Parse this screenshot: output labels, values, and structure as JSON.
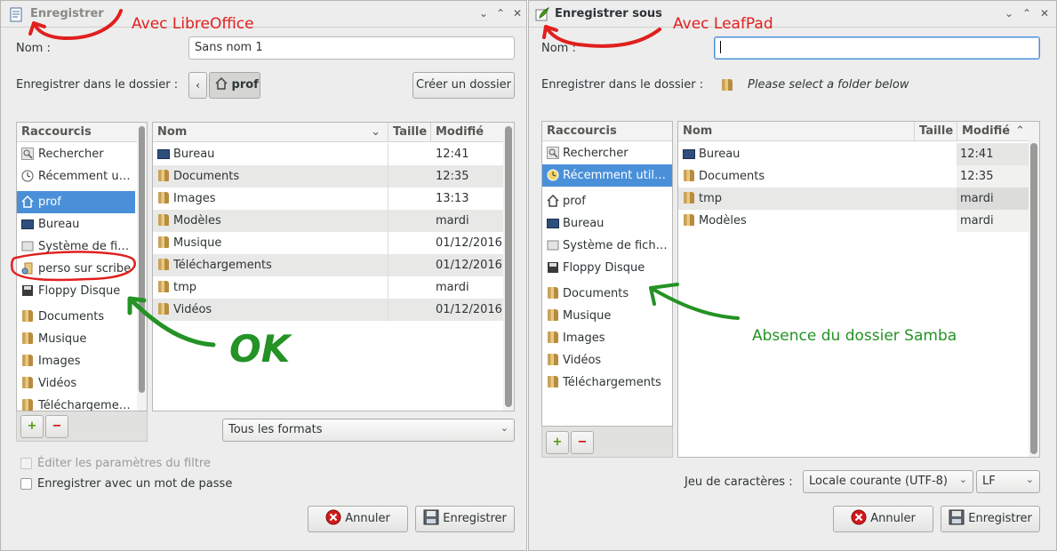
{
  "libreoffice": {
    "title": "Enregistrer",
    "annotation": "Avec LibreOffice",
    "name_label": "Nom :",
    "name_value": "Sans nom 1",
    "folder_label": "Enregistrer dans le dossier :",
    "path_current": "prof",
    "create_folder": "Créer un dossier",
    "places_header": "Raccourcis",
    "places": [
      {
        "label": "Rechercher",
        "icon": "search-icon"
      },
      {
        "label": "Récemment u…",
        "icon": "recent-icon"
      },
      {
        "label": "prof",
        "icon": "home-icon"
      },
      {
        "label": "Bureau",
        "icon": "desktop-icon"
      },
      {
        "label": "Système de fi…",
        "icon": "drive-icon"
      },
      {
        "label": "perso sur scribe",
        "icon": "network-icon"
      },
      {
        "label": "Floppy Disque",
        "icon": "floppy-icon"
      },
      {
        "label": "Documents",
        "icon": "folder-icon"
      },
      {
        "label": "Musique",
        "icon": "folder-icon"
      },
      {
        "label": "Images",
        "icon": "folder-icon"
      },
      {
        "label": "Vidéos",
        "icon": "folder-icon"
      },
      {
        "label": "Téléchargeme…",
        "icon": "folder-icon"
      }
    ],
    "columns": {
      "name": "Nom",
      "size": "Taille",
      "modified": "Modifié"
    },
    "files": [
      {
        "name": "Bureau",
        "size": "",
        "modified": "12:41"
      },
      {
        "name": "Documents",
        "size": "",
        "modified": "12:35"
      },
      {
        "name": "Images",
        "size": "",
        "modified": "13:13"
      },
      {
        "name": "Modèles",
        "size": "",
        "modified": "mardi"
      },
      {
        "name": "Musique",
        "size": "",
        "modified": "01/12/2016"
      },
      {
        "name": "Téléchargements",
        "size": "",
        "modified": "01/12/2016"
      },
      {
        "name": "tmp",
        "size": "",
        "modified": "mardi"
      },
      {
        "name": "Vidéos",
        "size": "",
        "modified": "01/12/2016"
      }
    ],
    "filter_value": "Tous les formats",
    "check_filter": "Éditer les paramètres du filtre",
    "check_password": "Enregistrer avec un mot de passe",
    "cancel": "Annuler",
    "save": "Enregistrer",
    "ok_annotation": "OK"
  },
  "leafpad": {
    "title": "Enregistrer sous",
    "annotation": "Avec LeafPad",
    "name_label": "Nom :",
    "name_value": "",
    "folder_label": "Enregistrer dans le dossier :",
    "folder_hint": "Please select a folder below",
    "places_header": "Raccourcis",
    "places": [
      {
        "label": "Rechercher",
        "icon": "search-icon"
      },
      {
        "label": "Récemment util…",
        "icon": "recent-icon"
      },
      {
        "label": "prof",
        "icon": "home-icon"
      },
      {
        "label": "Bureau",
        "icon": "desktop-icon"
      },
      {
        "label": "Système de fich…",
        "icon": "drive-icon"
      },
      {
        "label": "Floppy Disque",
        "icon": "floppy-icon"
      },
      {
        "label": "Documents",
        "icon": "folder-icon"
      },
      {
        "label": "Musique",
        "icon": "folder-icon"
      },
      {
        "label": "Images",
        "icon": "folder-icon"
      },
      {
        "label": "Vidéos",
        "icon": "folder-icon"
      },
      {
        "label": "Téléchargements",
        "icon": "folder-icon"
      }
    ],
    "columns": {
      "name": "Nom",
      "size": "Taille",
      "modified": "Modifié"
    },
    "files": [
      {
        "name": "Bureau",
        "size": "",
        "modified": "12:41"
      },
      {
        "name": "Documents",
        "size": "",
        "modified": "12:35"
      },
      {
        "name": "tmp",
        "size": "",
        "modified": "mardi"
      },
      {
        "name": "Modèles",
        "size": "",
        "modified": "mardi"
      }
    ],
    "charset_label": "Jeu de caractères :",
    "charset_value": "Locale courante (UTF-8)",
    "eol_value": "LF",
    "cancel": "Annuler",
    "save": "Enregistrer",
    "samba_annotation": "Absence du dossier Samba"
  },
  "colors": {
    "selection": "#4a90d9",
    "annotation_red": "#e0201e",
    "annotation_green": "#249225"
  }
}
